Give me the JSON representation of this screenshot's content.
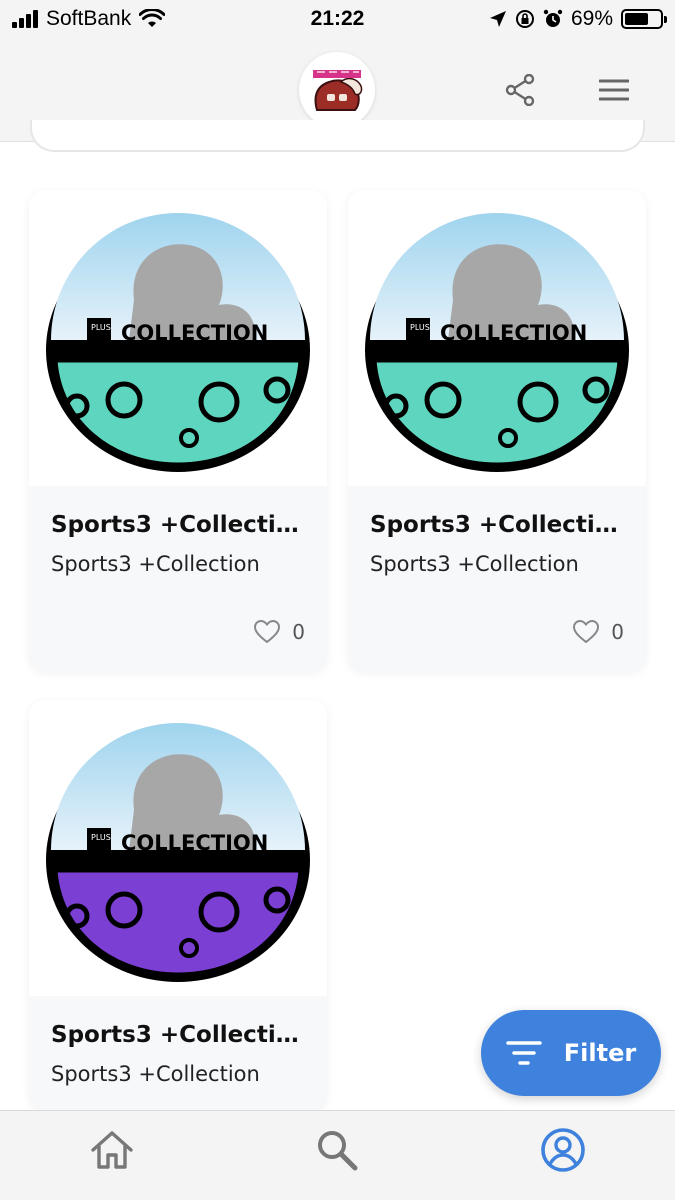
{
  "status_bar": {
    "carrier": "SoftBank",
    "time": "21:22",
    "battery_percent": "69%",
    "battery_level": 0.69
  },
  "header": {
    "logo_name": "app-logo",
    "share_icon": "share-icon",
    "menu_icon": "hamburger-menu-icon"
  },
  "items": [
    {
      "title": "Sports3 +Collectio…",
      "subtitle": "Sports3 +Collection",
      "likes": "0",
      "image_badge": "COLLECTION",
      "image_badge_small": "PLUS",
      "capsule_color": "#5ed6bf"
    },
    {
      "title": "Sports3 +Collectio…",
      "subtitle": "Sports3 +Collection",
      "likes": "0",
      "image_badge": "COLLECTION",
      "image_badge_small": "PLUS",
      "capsule_color": "#5ed6bf"
    },
    {
      "title": "Sports3 +Collectio…",
      "subtitle": "Sports3 +Collection",
      "likes": "0",
      "image_badge": "COLLECTION",
      "image_badge_small": "PLUS",
      "capsule_color": "#7b3fd4"
    }
  ],
  "filter_button": {
    "label": "Filter",
    "color": "#3f82dd"
  },
  "bottom_nav": {
    "items": [
      {
        "icon": "home-icon"
      },
      {
        "icon": "search-icon"
      },
      {
        "icon": "account-icon",
        "active_color": "#3f82dd"
      }
    ]
  }
}
